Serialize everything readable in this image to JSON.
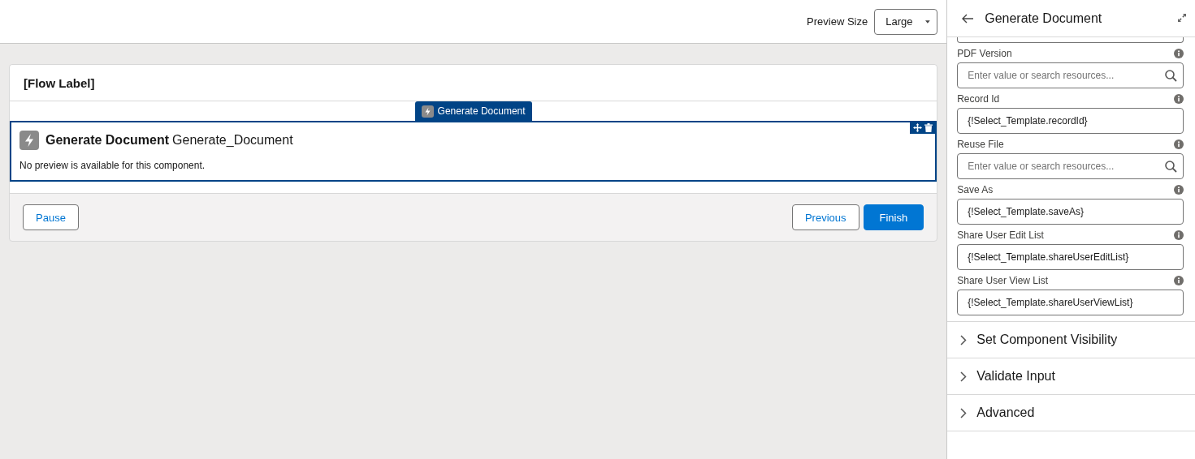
{
  "toolbar": {
    "preview_size_label": "Preview Size",
    "preview_size_value": "Large"
  },
  "flow": {
    "label": "[Flow Label]",
    "component_tab": "Generate Document",
    "component_title": "Generate Document",
    "component_api_name": "Generate_Document",
    "preview_note": "No preview is available for this component.",
    "selected": true
  },
  "footer_buttons": [
    {
      "label": "Pause",
      "kind": "neutral"
    },
    {
      "label": "Previous",
      "kind": "neutral"
    },
    {
      "label": "Finish",
      "kind": "brand"
    }
  ],
  "panel": {
    "title": "Generate Document",
    "fields": [
      {
        "label": "PDF Version",
        "kind": "search",
        "placeholder": "Enter value or search resources..."
      },
      {
        "label": "Record Id",
        "kind": "value",
        "value": "{!Select_Template.recordId}"
      },
      {
        "label": "Reuse File",
        "kind": "search",
        "placeholder": "Enter value or search resources..."
      },
      {
        "label": "Save As",
        "kind": "value",
        "value": "{!Select_Template.saveAs}"
      },
      {
        "label": "Share User Edit List",
        "kind": "value",
        "value": "{!Select_Template.shareUserEditList}"
      },
      {
        "label": "Share User View List",
        "kind": "value",
        "value": "{!Select_Template.shareUserViewList}"
      }
    ],
    "sections": [
      {
        "label": "Set Component Visibility",
        "expanded": false
      },
      {
        "label": "Validate Input",
        "expanded": false
      },
      {
        "label": "Advanced",
        "expanded": false
      }
    ]
  }
}
